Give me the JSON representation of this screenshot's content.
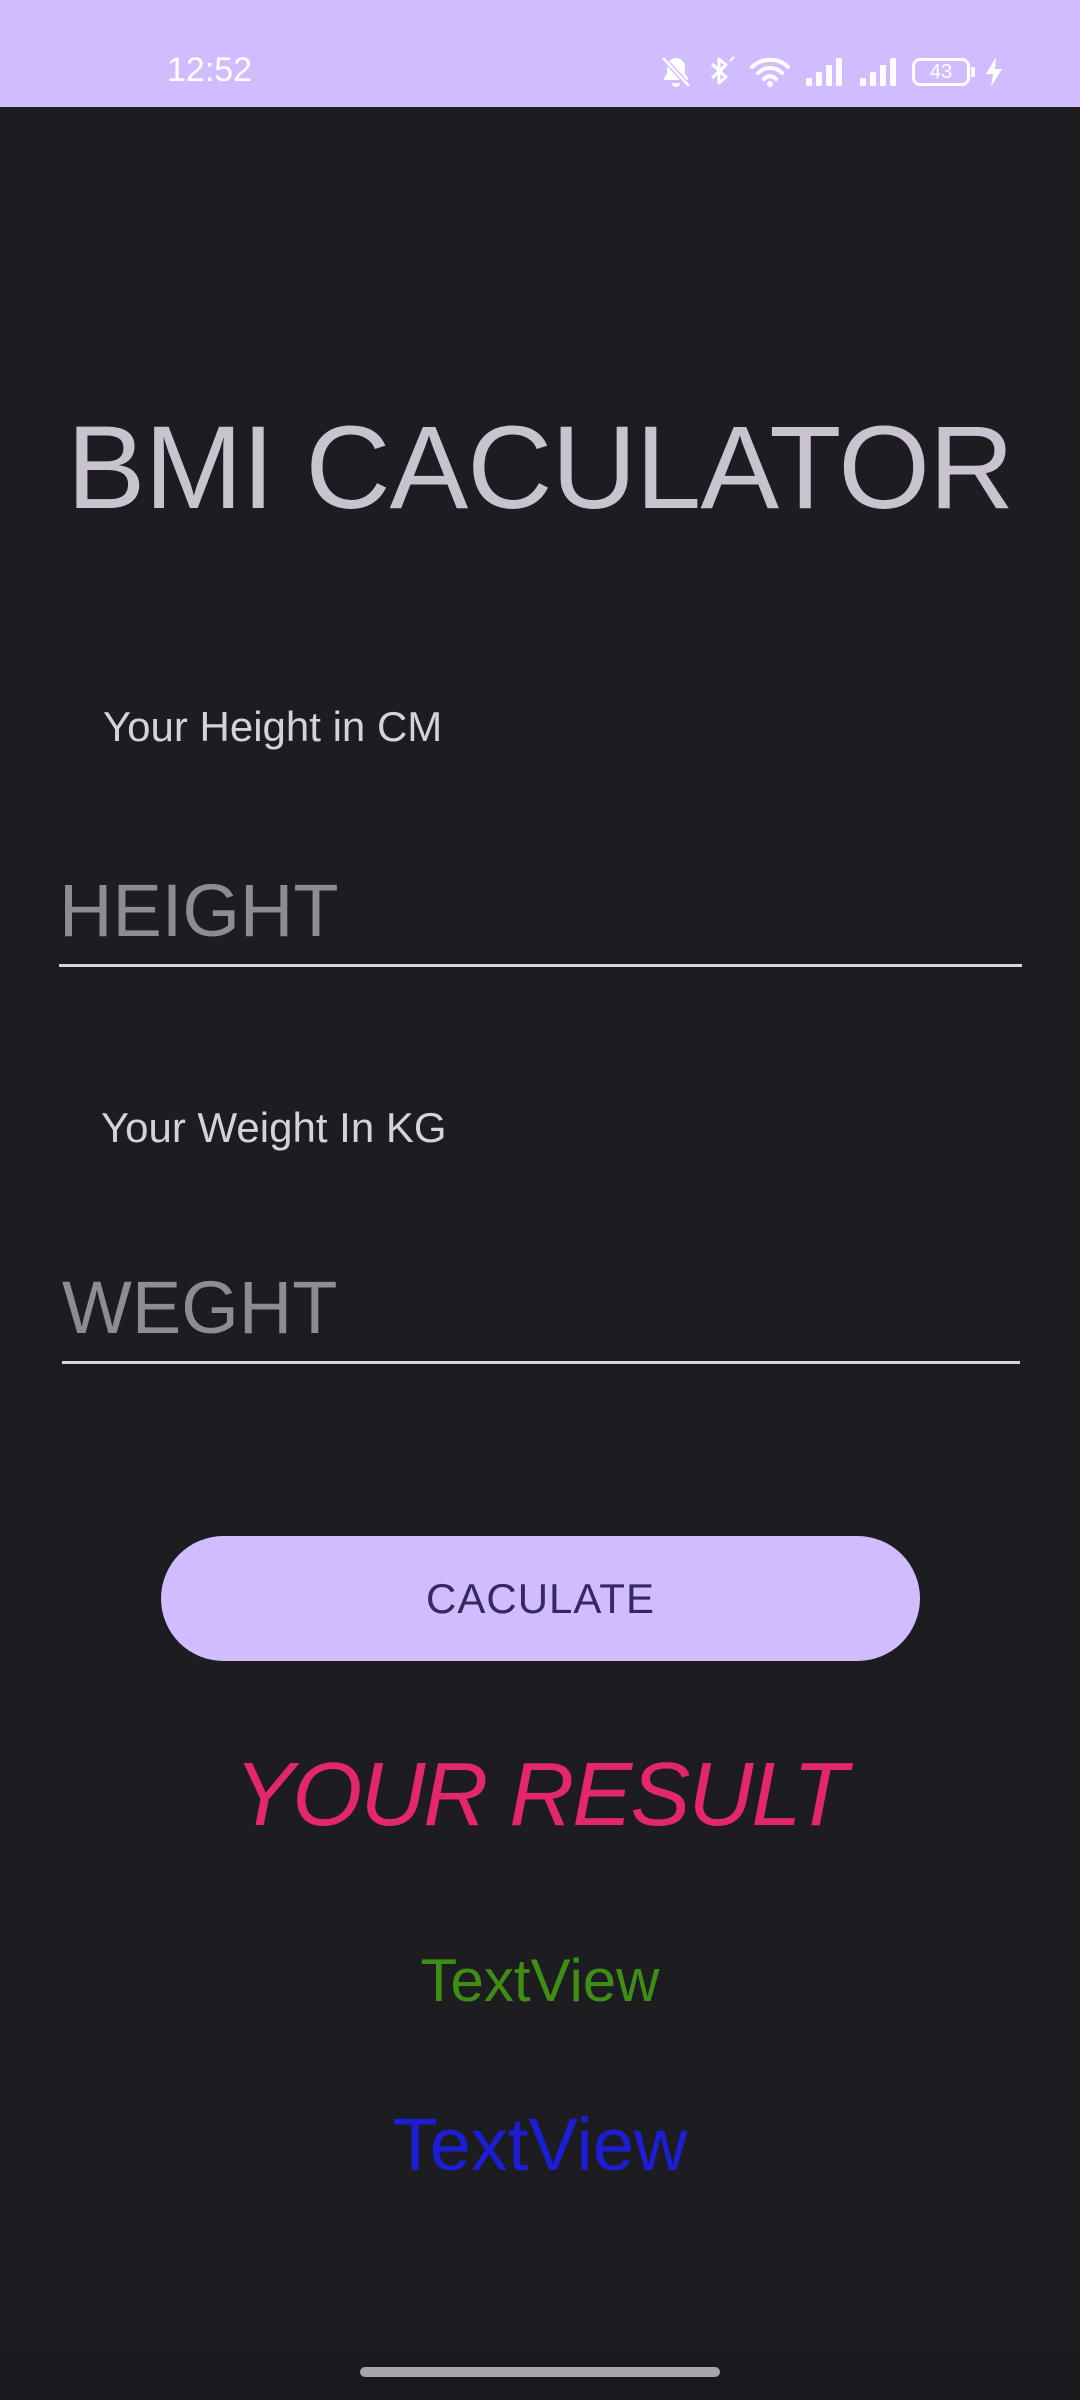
{
  "status_bar": {
    "time": "12:52",
    "battery_level": "43",
    "icons": [
      "bell-off-icon",
      "bluetooth-icon",
      "wifi-icon",
      "signal-icon",
      "signal-icon",
      "battery-icon",
      "charging-icon"
    ]
  },
  "app": {
    "title": "BMI CACULATOR"
  },
  "height_field": {
    "label": "Your Height in CM",
    "placeholder": "HEIGHT",
    "value": ""
  },
  "weight_field": {
    "label": "Your Weight In KG",
    "placeholder": "WEGHT",
    "value": ""
  },
  "calculate_button": {
    "label": "CACULATE"
  },
  "result": {
    "title": "YOUR RESULT",
    "value_text": "TextView",
    "category_text": "TextView"
  },
  "colors": {
    "accent": "#d0bcfe",
    "background": "#1d1c21",
    "result_title": "#e3276a",
    "result_value": "#3e8e16",
    "result_category": "#1c1ed6"
  }
}
